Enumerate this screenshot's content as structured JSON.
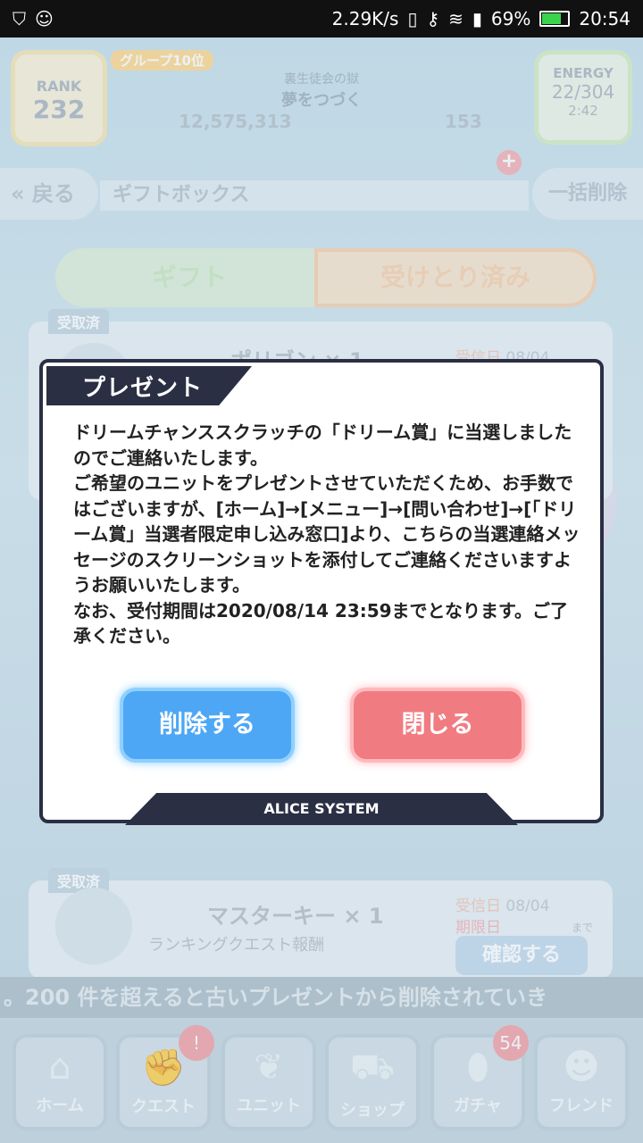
{
  "statusbar": {
    "net_speed": "2.29K/s",
    "battery_pct": "69%",
    "time": "20:54"
  },
  "header": {
    "rank_label": "RANK",
    "rank_value": "232",
    "group_rank": "グループ10位",
    "player_subtitle": "裏生徒会の獄",
    "player_name": "夢をつづく",
    "coins": "12,575,313",
    "gems": "153",
    "energy_label": "ENERGY",
    "energy_value": "22/304",
    "energy_timer": "2:42",
    "back_label": "戻る",
    "page_title": "ギフトボックス",
    "bulk_delete_label": "一括削除"
  },
  "tabs": {
    "gift": "ギフト",
    "received": "受けとり済み"
  },
  "list_items": [
    {
      "badge": "受取済",
      "title": "ポリゴン × 1",
      "date_label": "受信日",
      "date": "08/04"
    },
    {
      "badge": "受取済",
      "title": "マスターキー × 1",
      "subtitle": "ランキングクエスト報酬",
      "date_label": "受信日",
      "date": "08/04",
      "limit_label": "期限日",
      "limit_suffix": "まで",
      "confirm_label": "確認する"
    }
  ],
  "marquee": "。200 件を超えると古いプレゼントから削除されていき",
  "bottom_nav": [
    {
      "label": "ホーム",
      "icon": "home-icon"
    },
    {
      "label": "クエスト",
      "icon": "handshake-icon",
      "badge": "!"
    },
    {
      "label": "ユニット",
      "icon": "rabbit-icon"
    },
    {
      "label": "ショップ",
      "icon": "cart-icon"
    },
    {
      "label": "ガチャ",
      "icon": "egg-icon",
      "badge": "54"
    },
    {
      "label": "フレンド",
      "icon": "people-icon"
    }
  ],
  "dialog": {
    "title": "プレゼント",
    "body": "ドリームチャンススクラッチの「ドリーム賞」に当選しましたのでご連絡いたします。\nご希望のユニットをプレゼントさせていただくため、お手数ではございますが、[ホーム]→[メニュー]→[問い合わせ]→[「ドリーム賞」当選者限定申し込み窓口]より、こちらの当選連絡メッセージのスクリーンショットを添付してご連絡くださいますようお願いいたします。\nなお、受付期間は2020/08/14 23:59までとなります。ご了承ください。",
    "delete_label": "削除する",
    "close_label": "閉じる",
    "footer": "ALICE SYSTEM"
  }
}
